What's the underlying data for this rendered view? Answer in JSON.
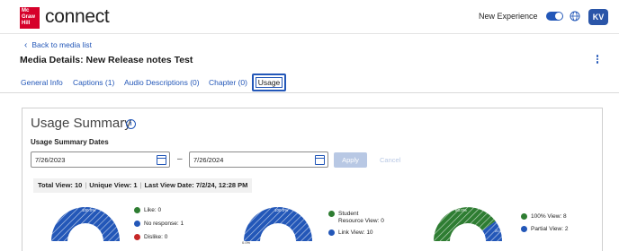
{
  "brand": {
    "logo_lines": [
      "Mc",
      "Graw",
      "Hill"
    ],
    "app_name": "connect",
    "logo_color": "#d6002a"
  },
  "header": {
    "new_experience_label": "New Experience",
    "toggle_on": true,
    "avatar_initials": "KV",
    "accent": "#2357b8"
  },
  "nav": {
    "back_label": "Back to media list"
  },
  "page": {
    "title": "Media Details: New Release notes Test"
  },
  "tabs": [
    {
      "label": "General Info"
    },
    {
      "label": "Captions  (1)"
    },
    {
      "label": "Audio Descriptions  (0)"
    },
    {
      "label": "Chapter  (0)"
    },
    {
      "label": "Usage",
      "active": true
    }
  ],
  "usage": {
    "title": "Usage Summary",
    "dates_label": "Usage Summary Dates",
    "start_date": "7/26/2023",
    "end_date": "7/26/2024",
    "apply_label": "Apply",
    "cancel_label": "Cancel",
    "stats": {
      "total": "Total View: 10",
      "unique": "Unique View: 1",
      "last": "Last View Date: 7/2/24, 12:28 PM"
    }
  },
  "gauges": [
    {
      "arc_label": "100.0%",
      "fill_color": "#2357b8",
      "fraction": 1.0,
      "legend": [
        {
          "label": "Like: 0",
          "color": "#2e7d32"
        },
        {
          "label": "No response: 1",
          "color": "#2357b8"
        },
        {
          "label": "Dislike: 0",
          "color": "#c62828"
        }
      ]
    },
    {
      "arc_label": "100.0%",
      "fill_color": "#2357b8",
      "fraction": 1.0,
      "bottom_label": "0.0%",
      "legend": [
        {
          "label": "Student Resource View: 0",
          "color": "#2e7d32"
        },
        {
          "label": "Link View: 10",
          "color": "#2357b8"
        }
      ]
    },
    {
      "arc_label": "80.0%",
      "fill_color": "#2e7d32",
      "fraction": 0.8,
      "secondary_label": "20.0%",
      "secondary_color": "#2357b8",
      "legend": [
        {
          "label": "100% View: 8",
          "color": "#2e7d32"
        },
        {
          "label": "Partial View: 2",
          "color": "#2357b8"
        }
      ]
    }
  ]
}
